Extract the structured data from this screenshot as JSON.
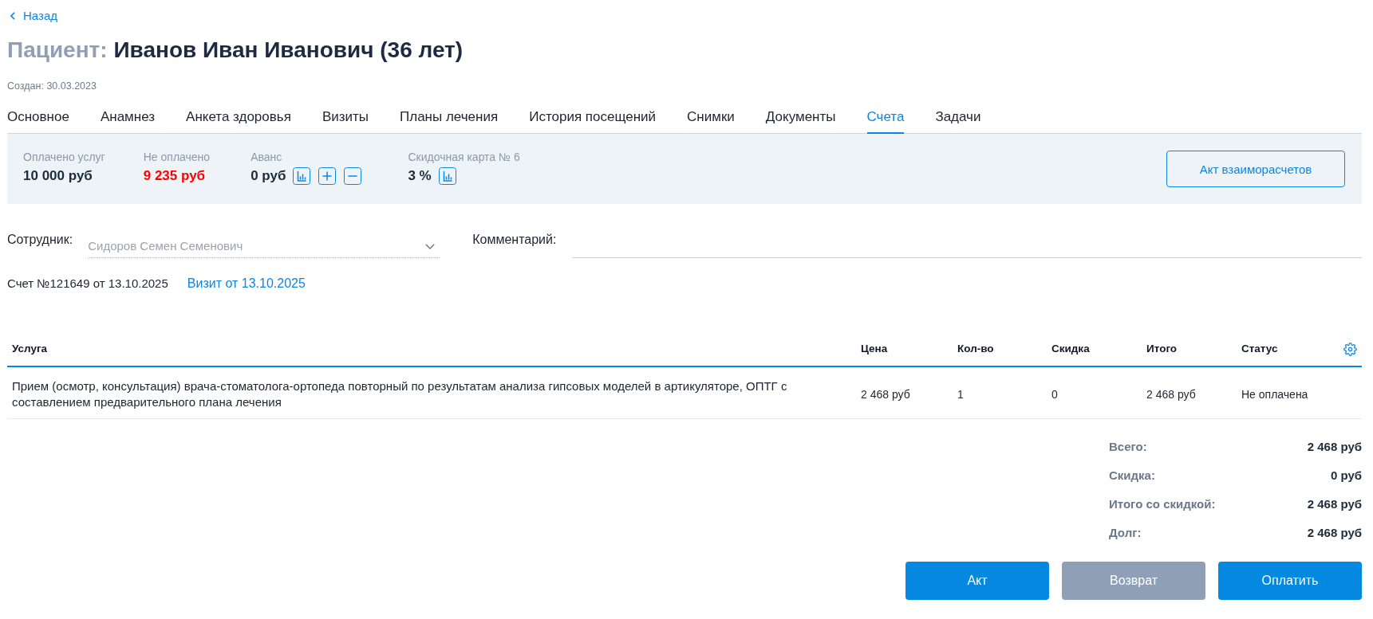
{
  "back_link": {
    "label": "Назад"
  },
  "header": {
    "title_label": "Пациент:",
    "patient_name": "Иванов Иван Иванович (36 лет)",
    "created": "Создан: 30.03.2023"
  },
  "tabs": [
    {
      "label": "Основное",
      "selected": false
    },
    {
      "label": "Анамнез",
      "selected": false
    },
    {
      "label": "Анкета здоровья",
      "selected": false
    },
    {
      "label": "Визиты",
      "selected": false
    },
    {
      "label": "Планы лечения",
      "selected": false
    },
    {
      "label": "История посещений",
      "selected": false
    },
    {
      "label": "Снимки",
      "selected": false
    },
    {
      "label": "Документы",
      "selected": false
    },
    {
      "label": "Счета",
      "selected": true
    },
    {
      "label": "Задачи",
      "selected": false
    }
  ],
  "summary": {
    "items": [
      {
        "kind": "plain",
        "label": "Оплачено услуг",
        "value": "10 000 руб",
        "color": "#1b2a3d"
      },
      {
        "kind": "plain",
        "label": "Не оплачено",
        "value": "9 235 руб",
        "color": "#ff0000"
      },
      {
        "kind": "balance",
        "label": "Аванс",
        "value": "0 руб",
        "color": "#1b2a3d"
      },
      {
        "kind": "discount",
        "label": "Скидочная карта № 6",
        "value": "3 %",
        "color": "#1b2a3d"
      }
    ],
    "button": "Акт взаиморасчетов"
  },
  "form": {
    "employee": {
      "label": "Сотрудник:",
      "value": "Сидоров Семен Семенович",
      "disabled": true
    },
    "comment": {
      "label": "Комментарий:"
    }
  },
  "invoice": {
    "number": "Счет №121649 от 13.10.2025",
    "visit_link": "Визит от 13.10.2025"
  },
  "table": {
    "columns": [
      "Услуга",
      "Цена",
      "Кол-во",
      "Скидка",
      "Итого",
      "Статус"
    ],
    "rows": [
      {
        "cells": [
          "Прием (осмотр, консультация) врача-стоматолога-ортопеда повторный по результатам анализа гипсовых моделей в артикуляторе, ОПТГ с составлением предварительного плана лечения",
          "2 468 руб",
          "1",
          "0",
          "2 468 руб",
          "Не оплачена"
        ]
      }
    ]
  },
  "totals": [
    {
      "label": "Всего:",
      "value": "2 468 руб"
    },
    {
      "label": "Скидка:",
      "value": "0 руб"
    },
    {
      "label": "Итого со скидкой:",
      "value": "2 468 руб"
    },
    {
      "label": "Долг:",
      "value": "2 468 руб"
    }
  ],
  "buttons": [
    {
      "label": "Акт",
      "disabled": false
    },
    {
      "label": "Возврат",
      "disabled": true
    },
    {
      "label": "Оплатить",
      "disabled": false
    }
  ]
}
